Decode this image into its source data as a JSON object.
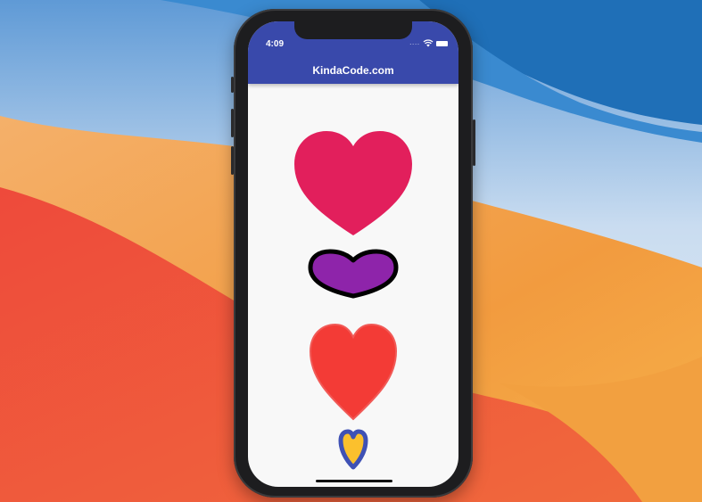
{
  "status_bar": {
    "time": "4:09",
    "signal": "....",
    "icons": [
      "wifi-icon",
      "battery-icon"
    ]
  },
  "app_bar": {
    "title": "KindaCode.com",
    "color": "#3949ab"
  },
  "hearts": [
    {
      "name": "heart-large-pink",
      "fill": "#e21f5c",
      "stroke": "none"
    },
    {
      "name": "heart-purple-outlined",
      "fill": "#8e24aa",
      "stroke": "#000000"
    },
    {
      "name": "heart-red-outlined",
      "fill": "#f33b36",
      "stroke": "#f15a57"
    },
    {
      "name": "heart-small-yellow",
      "fill": "#fbc02d",
      "stroke": "#3f51b5"
    }
  ],
  "background": {
    "screen": "#f8f8f8",
    "wallpaper": [
      "#1f6fb7",
      "#f0a64a",
      "#ef4d3c"
    ]
  }
}
